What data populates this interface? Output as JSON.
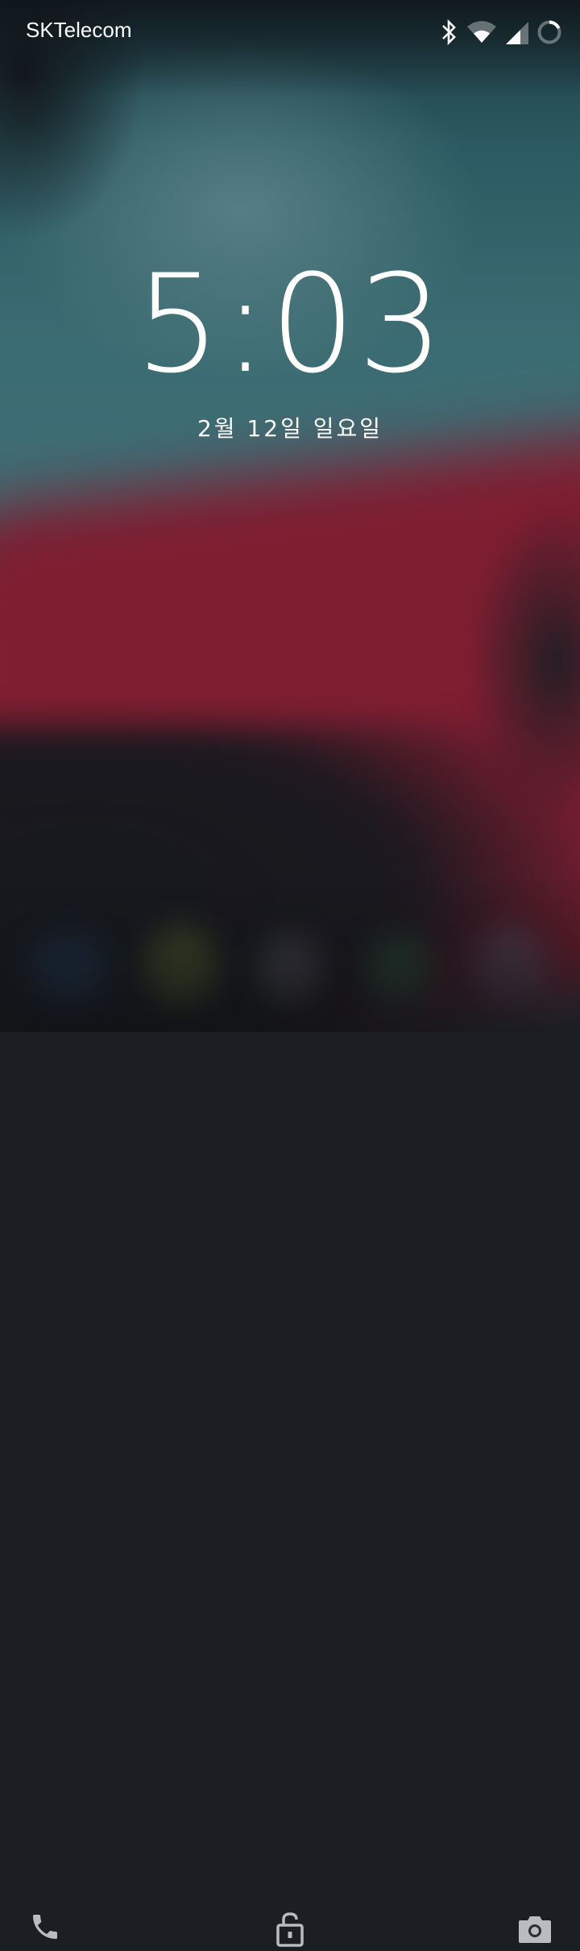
{
  "status_bar": {
    "carrier": "SKTelecom",
    "icons": [
      "bluetooth-icon",
      "wifi-icon",
      "cellular-signal-icon",
      "battery-charging-ring-icon"
    ]
  },
  "lockscreen": {
    "time": "5:03",
    "date": "2월 12일 일요일"
  },
  "bottom_actions": {
    "left": "phone-icon",
    "center": "unlock-padlock-icon",
    "right": "camera-icon"
  },
  "colors": {
    "teal": "#3e6d74",
    "crimson": "#7e1e31",
    "dark": "#1b1f24",
    "icon_grey": "#b8bcc0"
  }
}
